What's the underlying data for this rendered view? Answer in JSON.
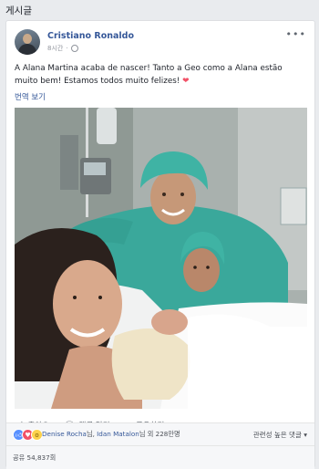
{
  "section": {
    "title": "게시글"
  },
  "post": {
    "author": "Cristiano Ronaldo",
    "time": "8시간",
    "more_icon": "more-icon",
    "caption": "A Alana Martina acaba de nascer! Tanto a Geo como a Alana estão muito bem! Estamos todos muito felizes!",
    "caption_emoji": "❤",
    "translate_label": "번역 보기"
  },
  "actions": {
    "like_label": "좋아요",
    "comment_label": "댓글 달기",
    "share_label": "공유하기"
  },
  "reactions": {
    "name1": "Denise Rocha",
    "sep1": "님, ",
    "name2": "Idan Matalon",
    "rest": "님 외 228만명",
    "sort_label": "관련성 높은 댓글 ▾"
  },
  "shares": {
    "label": "공유 54,837회"
  },
  "colors": {
    "link": "#365899",
    "scrub": "#3aa89b",
    "heart": "#f25268"
  }
}
